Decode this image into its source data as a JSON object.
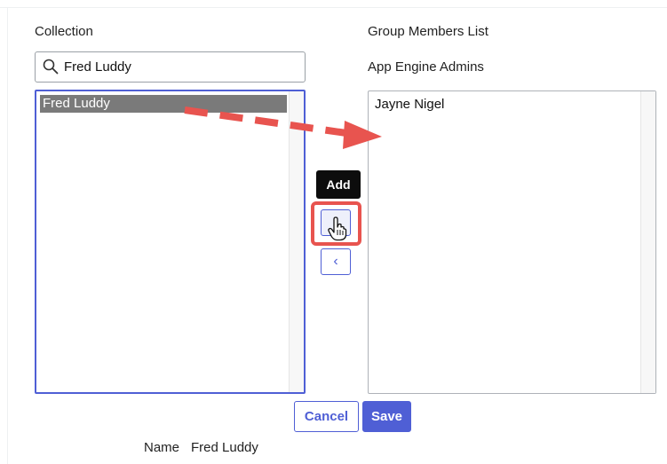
{
  "collection": {
    "heading": "Collection",
    "search_value": "Fred Luddy",
    "items": [
      {
        "label": "Fred Luddy",
        "selected": true
      }
    ]
  },
  "members": {
    "heading": "Group Members List",
    "group_name": "App Engine Admins",
    "items": [
      {
        "label": "Jayne Nigel"
      }
    ]
  },
  "controls": {
    "add_tooltip": "Add",
    "add_glyph": "›",
    "remove_glyph": "‹"
  },
  "actions": {
    "cancel_label": "Cancel",
    "save_label": "Save"
  },
  "footer": {
    "name_label": "Name",
    "name_value": "Fred Luddy"
  },
  "colors": {
    "accent": "#4f5fd5",
    "callout": "#e8544f",
    "selected_bg": "#7a7a7a"
  },
  "icons": {
    "search": "search-icon",
    "hand_cursor": "hand-pointer-icon",
    "drag_arrow": "dashed-arrow-icon"
  }
}
